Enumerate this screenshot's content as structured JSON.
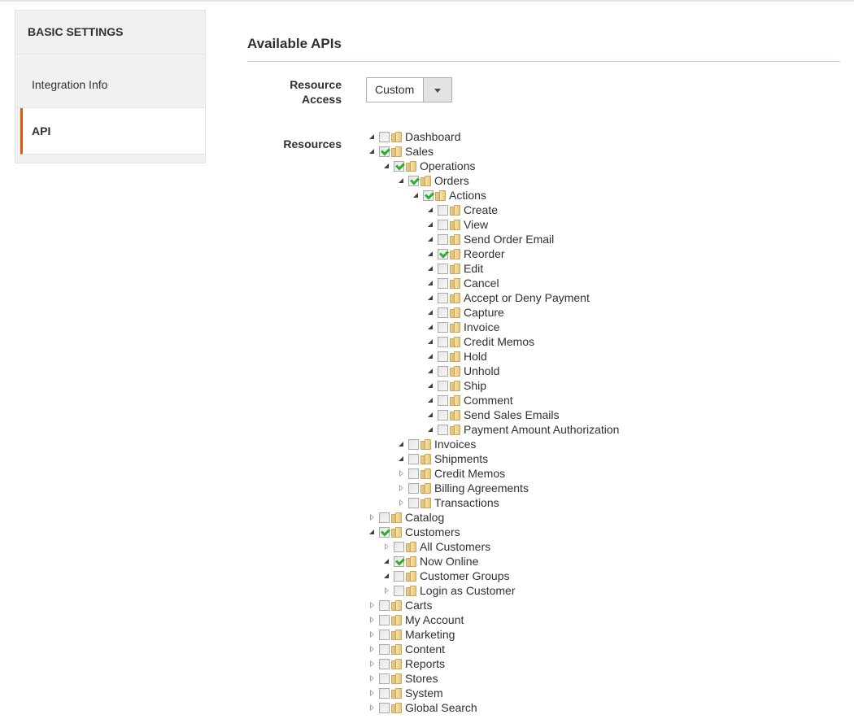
{
  "sidebar": {
    "title": "BASIC SETTINGS",
    "items": [
      {
        "label": "Integration Info",
        "active": false
      },
      {
        "label": "API",
        "active": true
      }
    ]
  },
  "main": {
    "section_title": "Available APIs",
    "resource_access": {
      "label": "Resource Access",
      "label_line1": "Resource",
      "label_line2": "Access",
      "value": "Custom"
    },
    "resources_label": "Resources"
  },
  "colors": {
    "accent": "#eb5202",
    "check": "#2fae2f"
  },
  "tree": [
    {
      "label": "Dashboard",
      "level": 0,
      "expanded": true,
      "checked": false
    },
    {
      "label": "Sales",
      "level": 0,
      "expanded": true,
      "checked": true
    },
    {
      "label": "Operations",
      "level": 1,
      "expanded": true,
      "checked": true
    },
    {
      "label": "Orders",
      "level": 2,
      "expanded": true,
      "checked": true
    },
    {
      "label": "Actions",
      "level": 3,
      "expanded": true,
      "checked": true
    },
    {
      "label": "Create",
      "level": 4,
      "expanded": true,
      "checked": false
    },
    {
      "label": "View",
      "level": 4,
      "expanded": true,
      "checked": false
    },
    {
      "label": "Send Order Email",
      "level": 4,
      "expanded": true,
      "checked": false
    },
    {
      "label": "Reorder",
      "level": 4,
      "expanded": true,
      "checked": true
    },
    {
      "label": "Edit",
      "level": 4,
      "expanded": true,
      "checked": false
    },
    {
      "label": "Cancel",
      "level": 4,
      "expanded": true,
      "checked": false
    },
    {
      "label": "Accept or Deny Payment",
      "level": 4,
      "expanded": true,
      "checked": false
    },
    {
      "label": "Capture",
      "level": 4,
      "expanded": true,
      "checked": false
    },
    {
      "label": "Invoice",
      "level": 4,
      "expanded": true,
      "checked": false
    },
    {
      "label": "Credit Memos",
      "level": 4,
      "expanded": true,
      "checked": false
    },
    {
      "label": "Hold",
      "level": 4,
      "expanded": true,
      "checked": false
    },
    {
      "label": "Unhold",
      "level": 4,
      "expanded": true,
      "checked": false
    },
    {
      "label": "Ship",
      "level": 4,
      "expanded": true,
      "checked": false
    },
    {
      "label": "Comment",
      "level": 4,
      "expanded": true,
      "checked": false
    },
    {
      "label": "Send Sales Emails",
      "level": 4,
      "expanded": true,
      "checked": false
    },
    {
      "label": "Payment Amount Authorization",
      "level": 4,
      "expanded": true,
      "checked": false
    },
    {
      "label": "Invoices",
      "level": 2,
      "expanded": true,
      "checked": false
    },
    {
      "label": "Shipments",
      "level": 2,
      "expanded": true,
      "checked": false
    },
    {
      "label": "Credit Memos",
      "level": 2,
      "expanded": false,
      "checked": false
    },
    {
      "label": "Billing Agreements",
      "level": 2,
      "expanded": false,
      "checked": false
    },
    {
      "label": "Transactions",
      "level": 2,
      "expanded": false,
      "checked": false
    },
    {
      "label": "Catalog",
      "level": 0,
      "expanded": false,
      "checked": false
    },
    {
      "label": "Customers",
      "level": 0,
      "expanded": true,
      "checked": true
    },
    {
      "label": "All Customers",
      "level": 1,
      "expanded": false,
      "checked": false
    },
    {
      "label": "Now Online",
      "level": 1,
      "expanded": true,
      "checked": true
    },
    {
      "label": "Customer Groups",
      "level": 1,
      "expanded": true,
      "checked": false
    },
    {
      "label": "Login as Customer",
      "level": 1,
      "expanded": false,
      "checked": false
    },
    {
      "label": "Carts",
      "level": 0,
      "expanded": false,
      "checked": false
    },
    {
      "label": "My Account",
      "level": 0,
      "expanded": false,
      "checked": false
    },
    {
      "label": "Marketing",
      "level": 0,
      "expanded": false,
      "checked": false
    },
    {
      "label": "Content",
      "level": 0,
      "expanded": false,
      "checked": false
    },
    {
      "label": "Reports",
      "level": 0,
      "expanded": false,
      "checked": false
    },
    {
      "label": "Stores",
      "level": 0,
      "expanded": false,
      "checked": false
    },
    {
      "label": "System",
      "level": 0,
      "expanded": false,
      "checked": false
    },
    {
      "label": "Global Search",
      "level": 0,
      "expanded": false,
      "checked": false
    }
  ]
}
